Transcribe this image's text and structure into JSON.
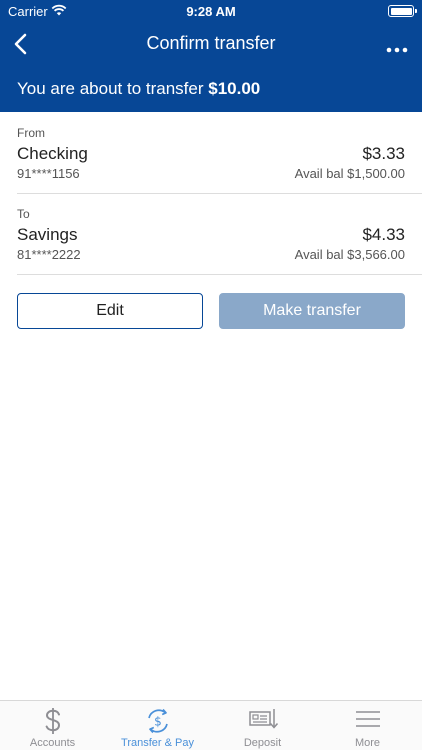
{
  "status_bar": {
    "carrier": "Carrier",
    "time": "9:28 AM"
  },
  "nav": {
    "title": "Confirm transfer",
    "back_icon": "chevron-left-icon",
    "more_icon": "more-horizontal-icon"
  },
  "banner": {
    "text": "You are about to transfer",
    "amount": "$10.00"
  },
  "from": {
    "label": "From",
    "name": "Checking",
    "number": "91****1156",
    "amount": "$3.33",
    "available": "Avail bal $1,500.00"
  },
  "to": {
    "label": "To",
    "name": "Savings",
    "number": "81****2222",
    "amount": "$4.33",
    "available": "Avail bal $3,566.00"
  },
  "buttons": {
    "edit": "Edit",
    "make_transfer": "Make transfer"
  },
  "tabs": [
    {
      "label": "Accounts",
      "icon": "dollar-icon"
    },
    {
      "label": "Transfer & Pay",
      "icon": "transfer-pay-icon",
      "active": true
    },
    {
      "label": "Deposit",
      "icon": "check-deposit-icon"
    },
    {
      "label": "More",
      "icon": "hamburger-menu-icon"
    }
  ],
  "colors": {
    "brand_blue": "#074796",
    "tab_active": "#4a90d9",
    "button_disabled": "#8aa8c9"
  }
}
